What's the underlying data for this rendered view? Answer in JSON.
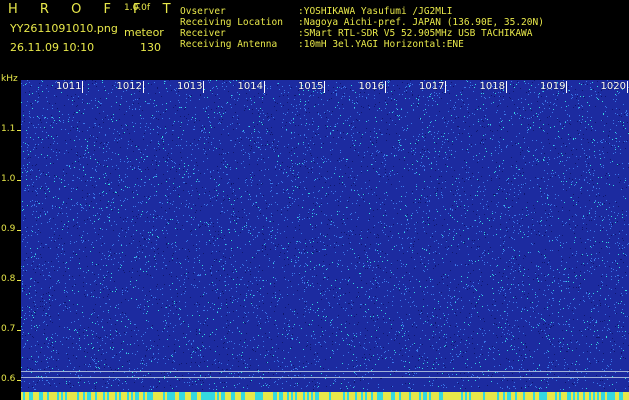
{
  "header": {
    "app_title": "H R O F F T",
    "version": "1.0.0f",
    "filename": "YY2611091010.png",
    "mode": "meteor",
    "timestamp": "26.11.09 10:10",
    "count": "130",
    "info": [
      {
        "key": "Ovserver",
        "value": ":YOSHIKAWA Yasufumi /JG2MLI"
      },
      {
        "key": "Receiving Location",
        "value": ":Nagoya Aichi-pref. JAPAN (136.90E, 35.20N)"
      },
      {
        "key": "Receiver",
        "value": ":SMart RTL-SDR V5 52.905MHz USB TACHIKAWA"
      },
      {
        "key": "Receiving Antenna",
        "value": ":10mH 3el.YAGI Horizontal:ENE"
      }
    ]
  },
  "spectrogram": {
    "freq_unit": "kHz",
    "y_ticks": [
      "1.1",
      "1.0",
      "0.9",
      "0.8",
      "0.7",
      "0.6"
    ],
    "y_values": [
      1.1,
      1.0,
      0.9,
      0.8,
      0.7,
      0.6
    ],
    "x_ticks": [
      "1011",
      "1012",
      "1013",
      "1014",
      "1015",
      "1016",
      "1017",
      "1018",
      "1019",
      "1020"
    ],
    "colors": {
      "background": "#1c2ba0",
      "noise_light": "#3a78e8",
      "noise_cyan": "#35d8e0",
      "bottom_band": "#e8e84a",
      "text": "#e8e84a"
    }
  }
}
